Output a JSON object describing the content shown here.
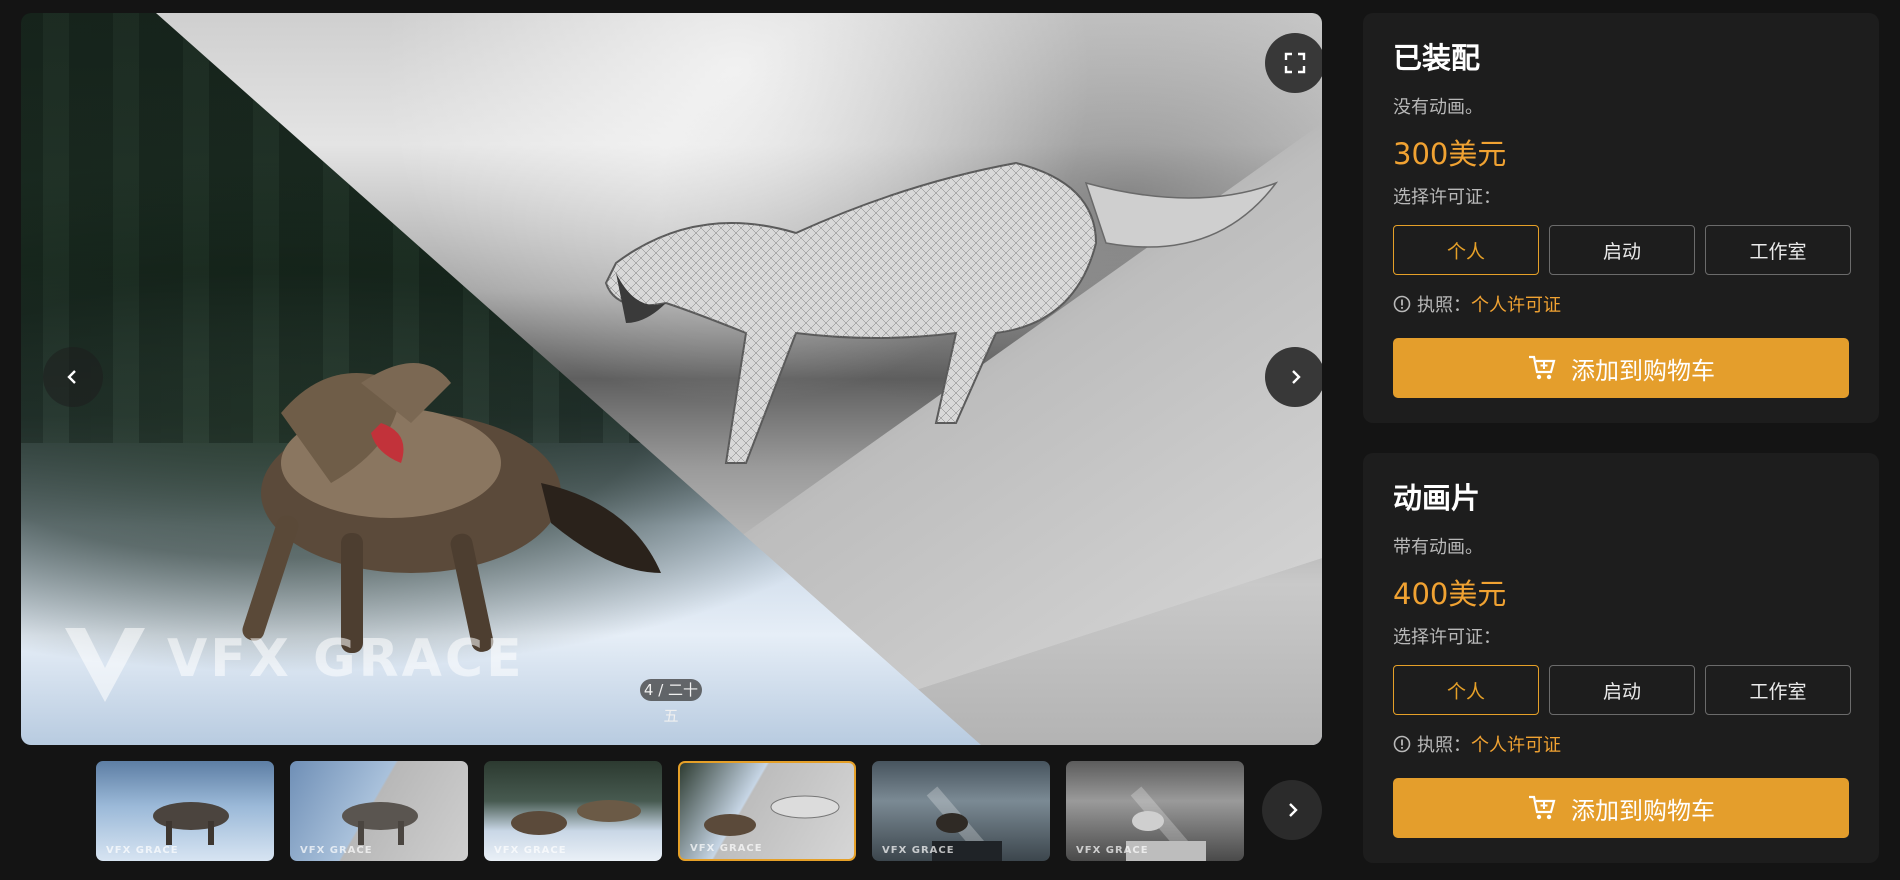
{
  "viewer": {
    "counter_top": "4 / 二十",
    "counter_bottom": "五",
    "watermark": "VFX GRACE"
  },
  "thumbnails": [
    {
      "name": "wolf-color-snow",
      "watermark": "VFX GRACE"
    },
    {
      "name": "wolf-color-gray-split",
      "watermark": "VFX GRACE"
    },
    {
      "name": "wolves-fight-color",
      "watermark": "VFX GRACE"
    },
    {
      "name": "wolves-fight-split",
      "watermark": "VFX GRACE",
      "active": true
    },
    {
      "name": "wolf-howl-color",
      "watermark": "VFX GRACE"
    },
    {
      "name": "wolf-howl-gray",
      "watermark": "VFX GRACE"
    }
  ],
  "products": [
    {
      "title": "已装配",
      "desc": "没有动画。",
      "price": "300美元",
      "license_label": "选择许可证：",
      "options": [
        "个人",
        "启动",
        "工作室"
      ],
      "selected_option": "个人",
      "license_prefix": "执照：",
      "license_value": "个人许可证",
      "cart_label": "添加到购物车"
    },
    {
      "title": "动画片",
      "desc": "带有动画。",
      "price": "400美元",
      "license_label": "选择许可证：",
      "options": [
        "个人",
        "启动",
        "工作室"
      ],
      "selected_option": "个人",
      "license_prefix": "执照：",
      "license_value": "个人许可证",
      "cart_label": "添加到购物车"
    }
  ],
  "colors": {
    "accent": "#e49e2c",
    "background": "#141414",
    "card": "#1d1d1d"
  }
}
